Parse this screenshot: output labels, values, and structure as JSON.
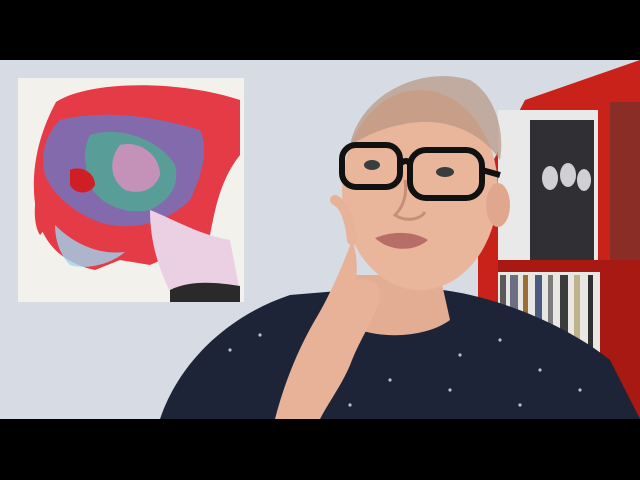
{
  "scene": {
    "description_colors": {
      "wall": "#d7dbe4",
      "shelf_red": "#c8221b",
      "shirt_navy": "#1d2438",
      "skin": "#e9b69c",
      "glasses": "#111111"
    },
    "icons": {
      "art": "album-art-painting-icon",
      "person": "presenter-icon",
      "shelf": "record-shelf-icon"
    }
  }
}
